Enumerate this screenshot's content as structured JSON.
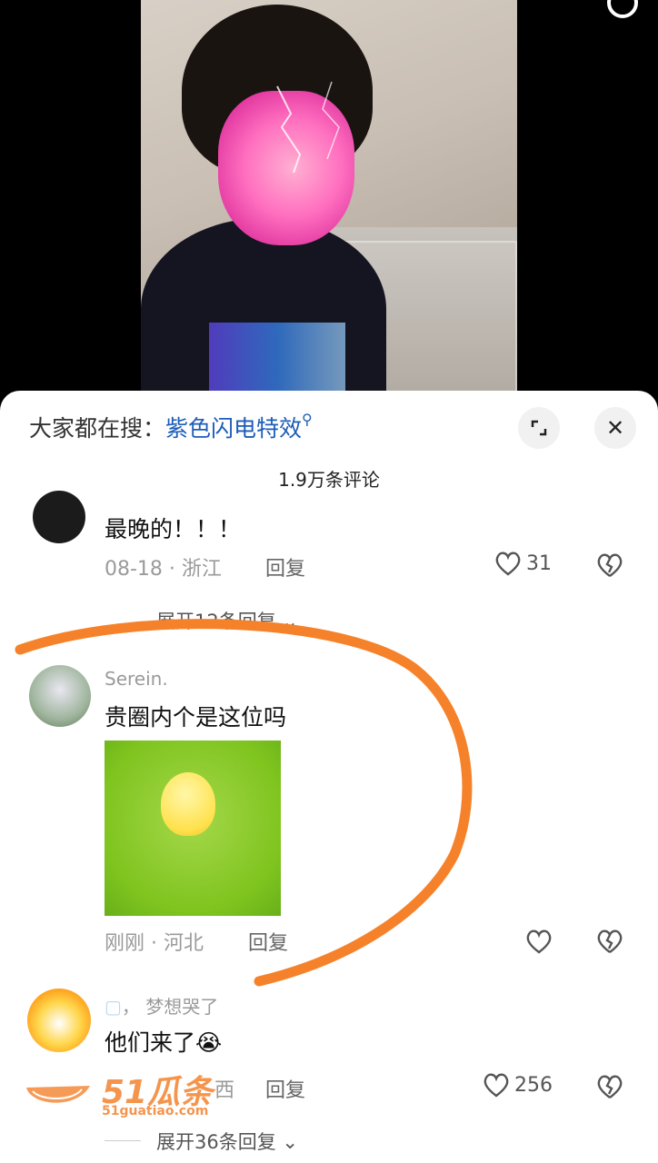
{
  "search_bar": {
    "prefix": "大家都在搜：",
    "keyword": "紫色闪电特效"
  },
  "comment_count": "1.9万条评论",
  "comments": [
    {
      "username": "",
      "text": "最晚的！！！",
      "date": "08-18",
      "location": "浙江",
      "reply_label": "回复",
      "likes": "31",
      "expand": "展开12条回复"
    },
    {
      "username": "Serein.",
      "text": "贵圈内个是这位吗",
      "has_sticker": true,
      "date": "刚刚",
      "location": "河北",
      "reply_label": "回复",
      "likes": ""
    },
    {
      "username": "梦想哭了",
      "username_prefix": "，",
      "text": "他们来了",
      "emoji": "😭",
      "date": "",
      "location": "西",
      "reply_label": "回复",
      "likes": "256",
      "expand": "展开36条回复"
    }
  ],
  "watermark": {
    "brand": "51瓜条",
    "url": "51guatiao.com"
  },
  "colors": {
    "keyword": "#1d5db8",
    "annotation": "#f5822a"
  }
}
